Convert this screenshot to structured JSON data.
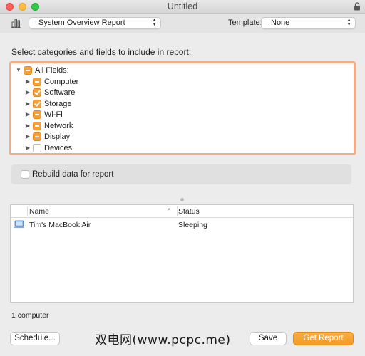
{
  "window": {
    "title": "Untitled"
  },
  "toolbar": {
    "report_type": "System Overview Report",
    "template_label": "Template:",
    "template_value": "None"
  },
  "fields": {
    "heading": "Select categories and fields to include in report:",
    "root": {
      "label": "All Fields:",
      "state": "mixed"
    },
    "items": [
      {
        "label": "Computer",
        "state": "mixed"
      },
      {
        "label": "Software",
        "state": "checked"
      },
      {
        "label": "Storage",
        "state": "checked"
      },
      {
        "label": "Wi-Fi",
        "state": "mixed"
      },
      {
        "label": "Network",
        "state": "mixed"
      },
      {
        "label": "Display",
        "state": "mixed"
      },
      {
        "label": "Devices",
        "state": "empty"
      }
    ]
  },
  "rebuild": {
    "label": "Rebuild data for report",
    "checked": false
  },
  "table": {
    "columns": [
      "Name",
      "Status"
    ],
    "rows": [
      {
        "name": "Tim's MacBook Air",
        "status": "Sleeping"
      }
    ]
  },
  "footer": {
    "count": "1 computer",
    "schedule_label": "Schedule...",
    "save_label": "Save",
    "get_report_label": "Get Report",
    "watermark": "双电网(www.pcpc.me)"
  },
  "colors": {
    "accent": "#f5a03c",
    "tree_border": "#f1ae86"
  }
}
